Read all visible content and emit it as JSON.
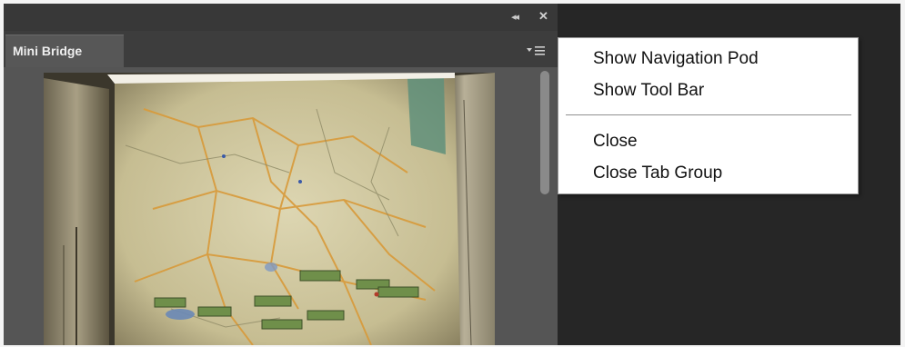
{
  "panel": {
    "tab_label": "Mini Bridge",
    "icons": {
      "collapse": "double-chevron-left-icon",
      "close": "close-icon",
      "panel_menu": "panel-menu-icon"
    }
  },
  "flyout_menu": {
    "group1": [
      "Show Navigation Pod",
      "Show Tool Bar"
    ],
    "group2": [
      "Close",
      "Close Tab Group"
    ]
  },
  "colors": {
    "panel_bg": "#474747",
    "workspace_bg": "#262626",
    "menu_bg": "#ffffff"
  }
}
